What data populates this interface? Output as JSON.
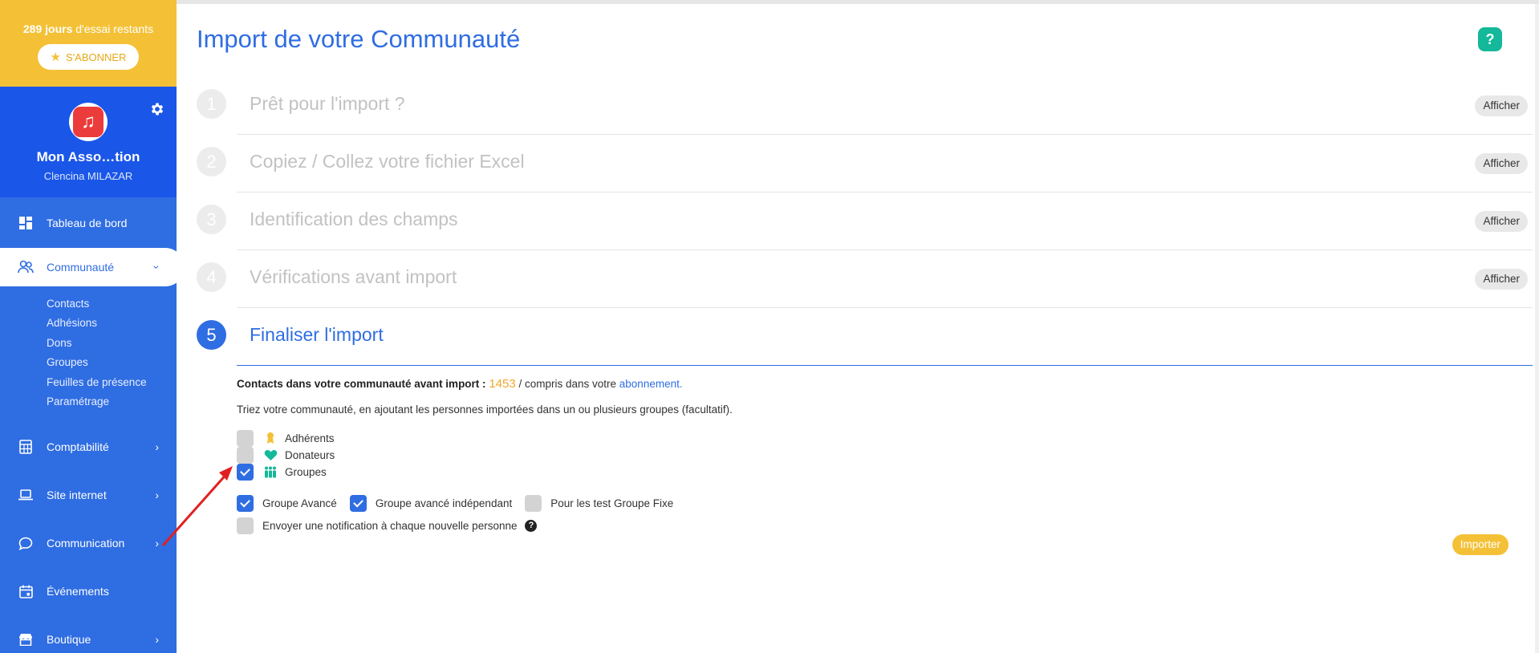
{
  "trial": {
    "days": "289 jours",
    "text": " d'essai restants",
    "subscribe_label": "S'ABONNER"
  },
  "profile": {
    "org_name": "Mon Asso…tion",
    "user_name": "Clencina MILAZAR"
  },
  "nav": {
    "dashboard": "Tableau de bord",
    "community": "Communauté",
    "community_sub": [
      "Contacts",
      "Adhésions",
      "Dons",
      "Groupes",
      "Feuilles de présence",
      "Paramétrage"
    ],
    "accounting": "Comptabilité",
    "website": "Site internet",
    "communication": "Communication",
    "events": "Événements",
    "shop": "Boutique"
  },
  "page": {
    "title": "Import de votre Communauté",
    "help": "?"
  },
  "steps": [
    {
      "num": "1",
      "title": "Prêt pour l'import ?",
      "action": "Afficher"
    },
    {
      "num": "2",
      "title": "Copiez / Collez votre fichier Excel",
      "action": "Afficher"
    },
    {
      "num": "3",
      "title": "Identification des champs",
      "action": "Afficher"
    },
    {
      "num": "4",
      "title": "Vérifications avant import",
      "action": "Afficher"
    },
    {
      "num": "5",
      "title": "Finaliser l'import"
    }
  ],
  "finalize": {
    "contacts_label": "Contacts dans votre communauté avant import :",
    "contacts_count": "1453",
    "contacts_suffix": "/ compris dans votre",
    "subscription_link": "abonnement.",
    "sort_text": "Triez votre communauté, en ajoutant les personnes importées dans un ou plusieurs groupes (facultatif).",
    "categories": [
      {
        "label": "Adhérents",
        "checked": false,
        "icon": "medal-icon"
      },
      {
        "label": "Donateurs",
        "checked": false,
        "icon": "heart-hand-icon"
      },
      {
        "label": "Groupes",
        "checked": true,
        "icon": "group-people-icon"
      }
    ],
    "groups": [
      {
        "label": "Groupe Avancé",
        "checked": true
      },
      {
        "label": "Groupe avancé indépendant",
        "checked": true
      },
      {
        "label": "Pour les test Groupe Fixe",
        "checked": false
      }
    ],
    "notification_label": "Envoyer une notification à chaque nouvelle personne",
    "import_label": "Importer"
  },
  "colors": {
    "primary": "#2f6de2",
    "accent": "#f4c136",
    "help": "#14b89a",
    "annotation_arrow": "#e02020"
  }
}
